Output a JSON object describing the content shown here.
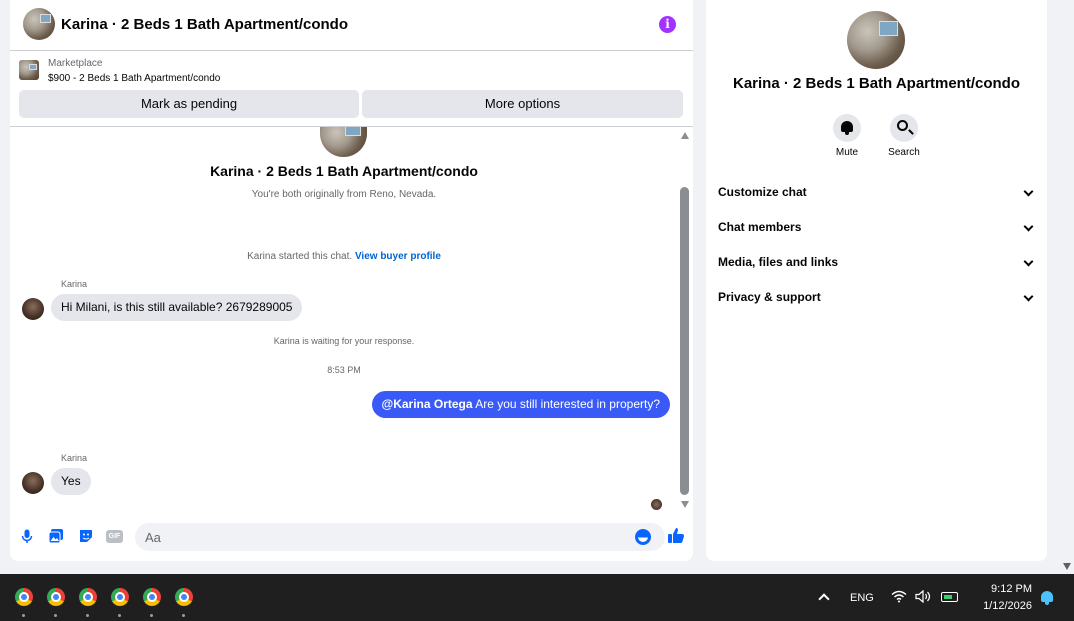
{
  "chat": {
    "title": "Karina · 2 Beds 1 Bath Apartment/condo",
    "marketplace_label": "Marketplace",
    "marketplace_item": "$900 - 2 Beds 1 Bath Apartment/condo",
    "mark_pending_label": "Mark as pending",
    "more_options_label": "More options",
    "info_icon_glyph": "i",
    "conversation_title": "Karina · 2 Beds 1 Bath Apartment/condo",
    "conversation_subtitle": "You're both originally from Reno, Nevada.",
    "started_text": "Karina started this chat. ",
    "buyer_profile_link": "View buyer profile",
    "messages": [
      {
        "sender": "Karina",
        "text": "Hi Milani, is this still available? 2679289005"
      },
      {
        "sender": "Karina",
        "text": "Yes"
      }
    ],
    "waiting_text": "Karina is waiting for your response.",
    "timestamp": "8:53 PM",
    "outgoing_mention": "@Karina Ortega",
    "outgoing_text": " Are you still interested in property?",
    "composer_placeholder": "Aa",
    "gif_label": "GIF"
  },
  "info_panel": {
    "title": "Karina · 2 Beds 1 Bath Apartment/condo",
    "mute_label": "Mute",
    "search_label": "Search",
    "sections": [
      "Customize chat",
      "Chat members",
      "Media, files and links",
      "Privacy & support"
    ]
  },
  "taskbar": {
    "app_icons": [
      "chrome-icon",
      "chrome-icon",
      "chrome-icon",
      "chrome-icon",
      "chrome-icon",
      "chrome-icon"
    ],
    "language": "ENG",
    "time": "9:12 PM",
    "date": "1/12/2026"
  },
  "colors": {
    "accent": "#0866ff",
    "outgoing_bubble": "#3a5af7",
    "info_icon": "#a033ff",
    "taskbar": "#1f1f1f"
  }
}
